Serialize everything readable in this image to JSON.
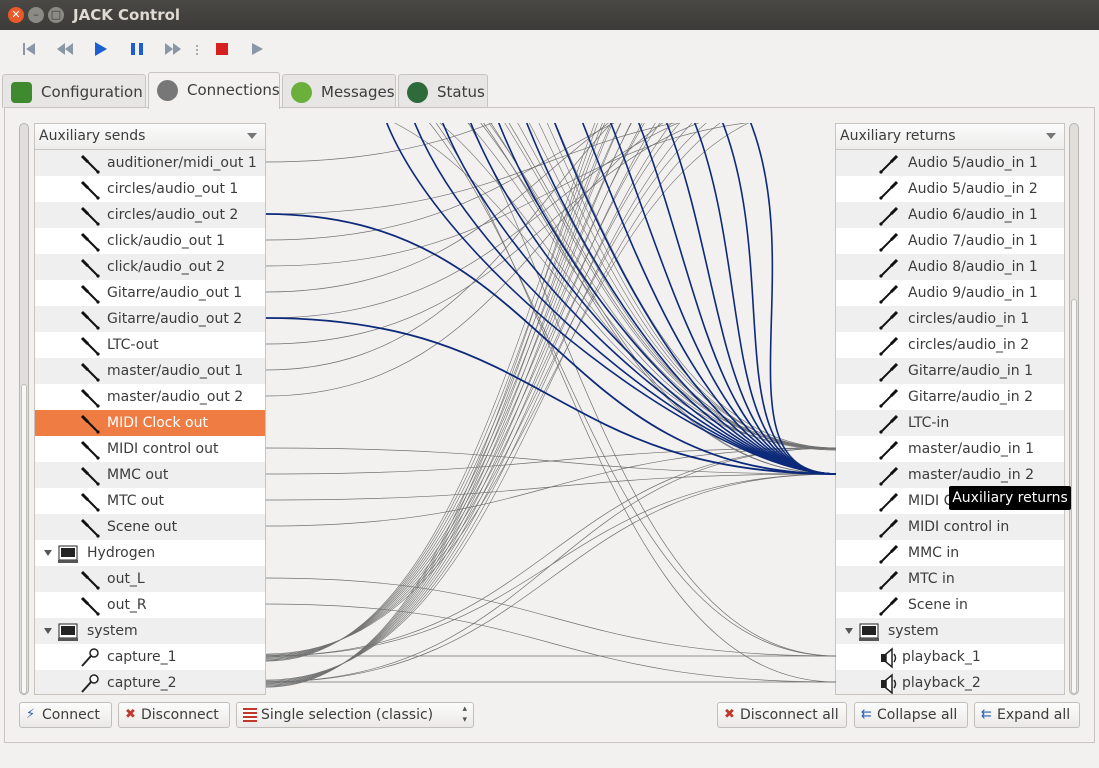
{
  "window": {
    "title": "JACK Control"
  },
  "tabs": [
    {
      "label": "Configuration"
    },
    {
      "label": "Connections"
    },
    {
      "label": "Messages"
    },
    {
      "label": "Status"
    }
  ],
  "left": {
    "header": "Auxiliary sends",
    "rows": [
      "auditioner/midi_out 1",
      "circles/audio_out 1",
      "circles/audio_out 2",
      "click/audio_out 1",
      "click/audio_out 2",
      "Gitarre/audio_out 1",
      "Gitarre/audio_out 2",
      "LTC-out",
      "master/audio_out 1",
      "master/audio_out 2",
      "MIDI Clock out",
      "MIDI control out",
      "MMC out",
      "MTC out",
      "Scene out",
      "Hydrogen",
      "out_L",
      "out_R",
      "system",
      "capture_1",
      "capture_2"
    ]
  },
  "right": {
    "header": "Auxiliary returns",
    "rows": [
      "Audio 5/audio_in 1",
      "Audio 5/audio_in 2",
      "Audio 6/audio_in 1",
      "Audio 7/audio_in 1",
      "Audio 8/audio_in 1",
      "Audio 9/audio_in 1",
      "circles/audio_in 1",
      "circles/audio_in 2",
      "Gitarre/audio_in 1",
      "Gitarre/audio_in 2",
      "LTC-in",
      "master/audio_in 1",
      "master/audio_in 2",
      "MIDI Clock in",
      "MIDI control in",
      "MMC in",
      "MTC in",
      "Scene in",
      "system",
      "playback_1",
      "playback_2"
    ]
  },
  "tooltip": "Auxiliary returns",
  "buttons": {
    "connect": "Connect",
    "disconnect": "Disconnect",
    "selection_mode": "Single selection (classic)",
    "disconnect_all": "Disconnect all",
    "collapse_all": "Collapse all",
    "expand_all": "Expand all"
  },
  "colors": {
    "selection": "#ef7d43",
    "connection_highlight": "#0d2a7a",
    "connection": "#707070"
  }
}
